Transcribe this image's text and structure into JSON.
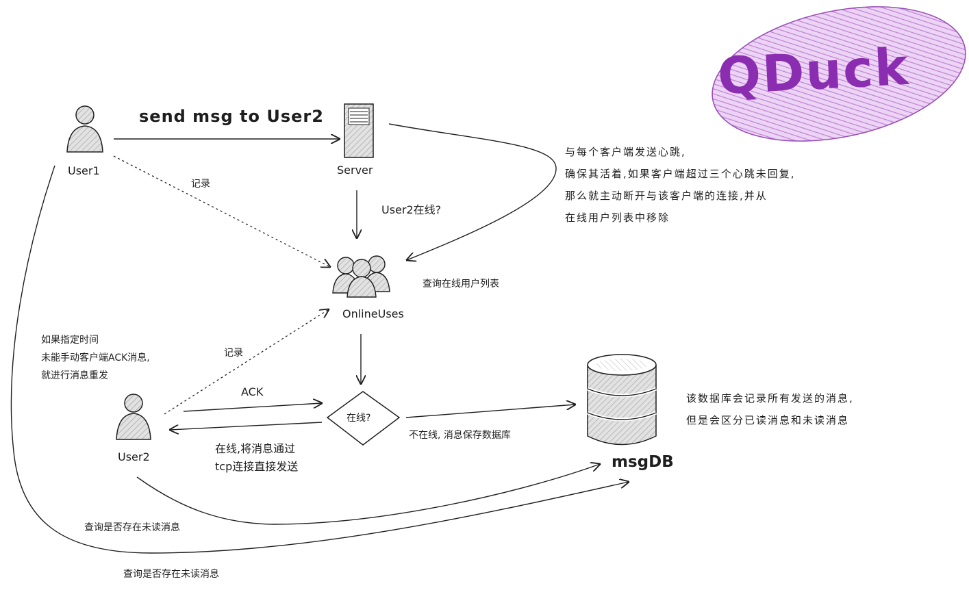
{
  "logo": {
    "text": "QDuck",
    "fill_color": "#c080d8",
    "text_color": "#8a2db0"
  },
  "nodes": {
    "user1": {
      "label": "User1",
      "icon": "user-icon"
    },
    "user2": {
      "label": "User2",
      "icon": "user-icon"
    },
    "server": {
      "label": "Server",
      "icon": "server-icon"
    },
    "online": {
      "label": "OnlineUses",
      "icon": "users-group-icon"
    },
    "decision": {
      "label": "在线?",
      "icon": "diamond-decision"
    },
    "db": {
      "label": "msgDB",
      "icon": "database-icon"
    }
  },
  "edges": {
    "send": "send msg to User2",
    "online_q": "User2在线?",
    "record1": "记录",
    "record2": "记录",
    "ack": "ACK",
    "query_online": "查询在线用户列表",
    "not_online": "不在线, 消息保存数据库",
    "online_send_lines": [
      "在线,将消息通过",
      "tcp连接直接发送"
    ],
    "unread1": "查询是否存在未读消息",
    "unread2": "查询是否存在未读消息"
  },
  "notes": {
    "heartbeat": [
      "与每个客户端发送心跳,",
      "确保其活着,如果客户端超过三个心跳未回复,",
      "那么就主动断开与该客户端的连接,并从",
      "在线用户列表中移除"
    ],
    "resend": [
      "如果指定时间",
      "未能手动客户端ACK消息,",
      "就进行消息重发"
    ],
    "db": [
      "该数据库会记录所有发送的消息,",
      "但是会区分已读消息和未读消息"
    ]
  },
  "colors": {
    "stroke": "#1e1e1e",
    "icon_fill": "#cfcfcf"
  }
}
